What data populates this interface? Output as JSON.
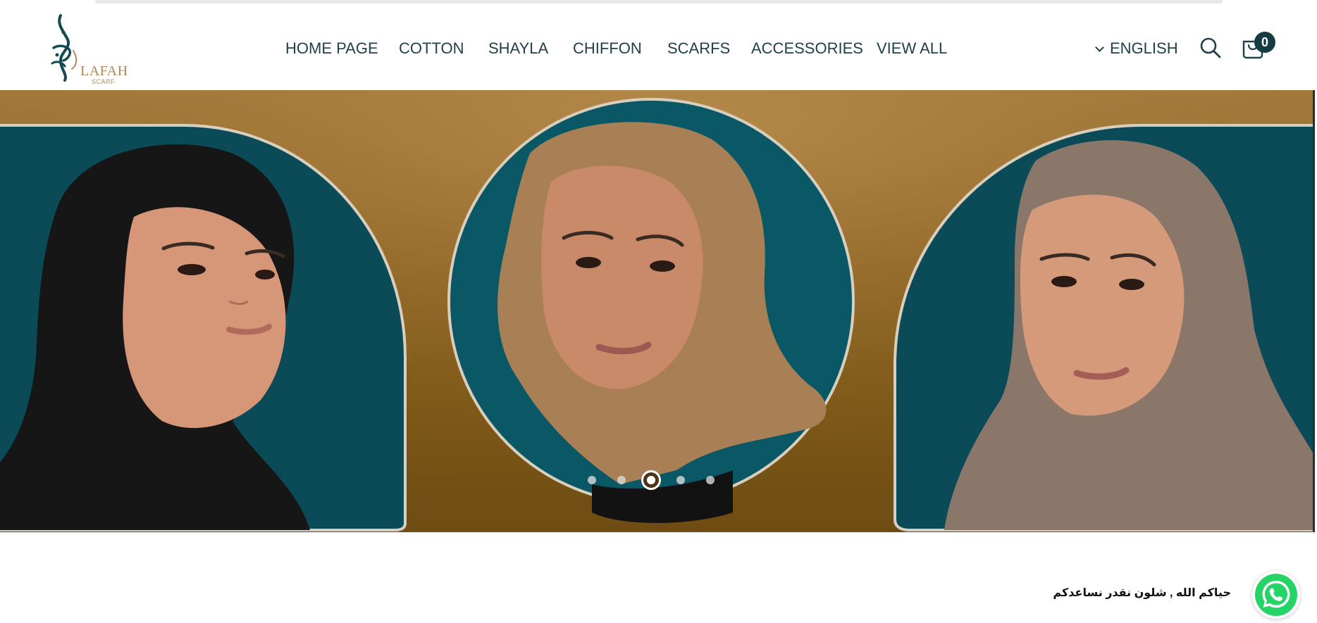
{
  "header": {
    "logo": {
      "wordmark": "LAFAH",
      "subline": "SCARF"
    },
    "nav": [
      {
        "label": "HOME PAGE"
      },
      {
        "label": "COTTON"
      },
      {
        "label": "SHAYLA"
      },
      {
        "label": "CHIFFON"
      },
      {
        "label": "SCARFS"
      },
      {
        "label": "ACCESSORIES"
      },
      {
        "label": "VIEW ALL"
      }
    ],
    "language": "ENGLISH",
    "cart_count": "0",
    "icons": {
      "search": "search-icon",
      "cart": "shopping-bag-icon",
      "language_caret": "chevron-down-icon"
    }
  },
  "hero": {
    "slide_count": 5,
    "active_slide_index": 2,
    "colors": {
      "background": "#8f6526",
      "panel": "#0b4a57",
      "outline": "#d8cfbf"
    }
  },
  "chat": {
    "message": "حياكم الله , شلون نقدر نساعدكم",
    "icon": "whatsapp-icon"
  }
}
